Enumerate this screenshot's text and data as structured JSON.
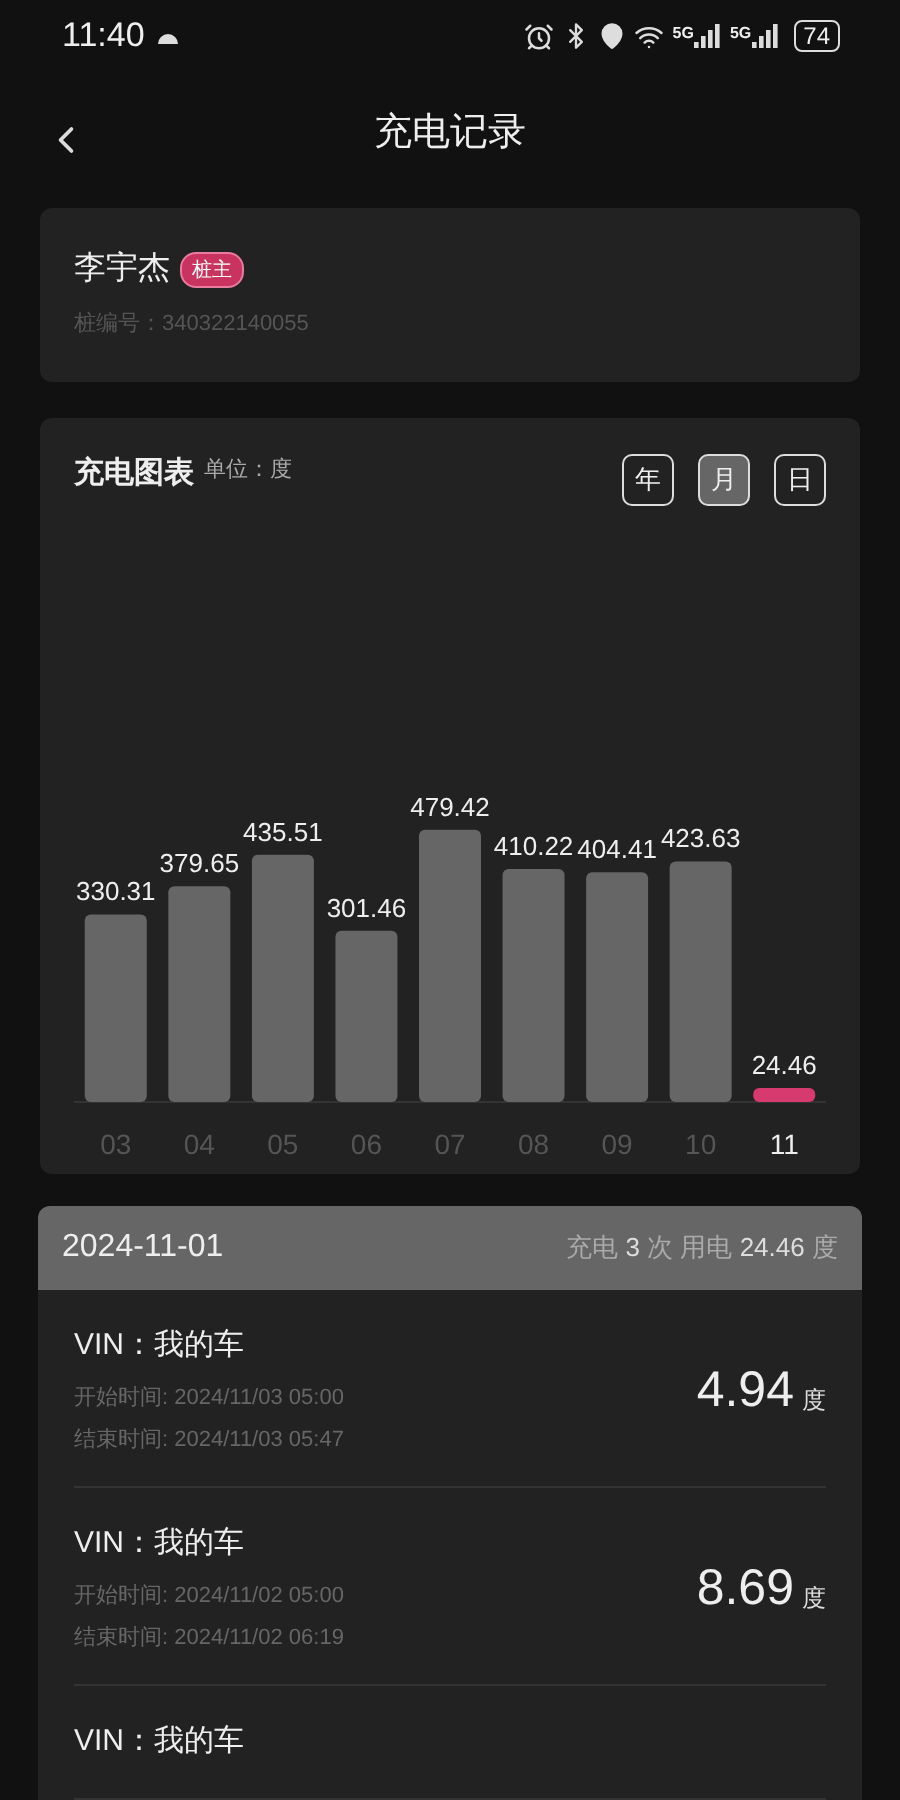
{
  "status_bar": {
    "time": "11:40",
    "network_1": "5G",
    "network_2": "5G",
    "battery": "74"
  },
  "header": {
    "title": "充电记录"
  },
  "owner": {
    "name": "李宇杰",
    "badge": "桩主",
    "pile_number": "桩编号：340322140055"
  },
  "chart_card": {
    "title": "充电图表",
    "unit": "单位：度",
    "periods": [
      {
        "label": "年",
        "selected": false
      },
      {
        "label": "月",
        "selected": true
      },
      {
        "label": "日",
        "selected": false
      }
    ],
    "chart_data": {
      "type": "bar",
      "categories": [
        "03",
        "04",
        "05",
        "06",
        "07",
        "08",
        "09",
        "10",
        "11"
      ],
      "stacked": true,
      "data_labels": true,
      "series": [
        {
          "color": "#666666",
          "values": [
            330.31,
            379.65,
            435.51,
            301.46,
            479.42,
            410.22,
            404.41,
            423.63,
            null
          ]
        },
        {
          "color": "#d63a6e",
          "values": [
            null,
            null,
            null,
            null,
            null,
            null,
            null,
            null,
            24.46
          ]
        }
      ]
    }
  },
  "day": {
    "date": "2024-11-01",
    "summary": "充电 **3** 次 用电 **24.46** 度",
    "records": [
      {
        "vin": "VIN：我的车",
        "start": "开始时间: 2024/11/03 05:00",
        "end": "结束时间: 2024/11/03 05:47",
        "amount": "4.94",
        "unit": "度"
      },
      {
        "vin": "VIN：我的车",
        "start": "开始时间: 2024/11/02 05:00",
        "end": "结束时间: 2024/11/02 06:19",
        "amount": "8.69",
        "unit": "度"
      },
      {
        "vin": "VIN：我的车"
      }
    ]
  }
}
